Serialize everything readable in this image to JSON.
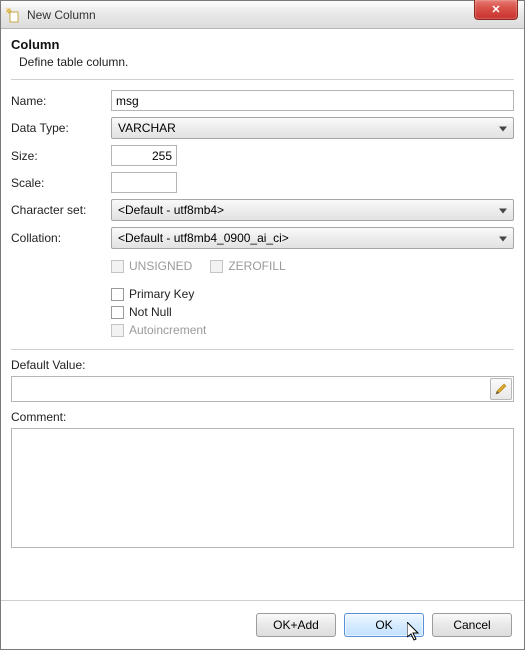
{
  "window": {
    "title": "New Column",
    "close_glyph": "✕"
  },
  "header": {
    "title": "Column",
    "subtitle": "Define table column."
  },
  "labels": {
    "name": "Name:",
    "datatype": "Data Type:",
    "size": "Size:",
    "scale": "Scale:",
    "charset": "Character set:",
    "collation": "Collation:",
    "unsigned": "UNSIGNED",
    "zerofill": "ZEROFILL",
    "primary": "Primary Key",
    "notnull": "Not Null",
    "autoinc": "Autoincrement",
    "default": "Default Value:",
    "comment": "Comment:"
  },
  "values": {
    "name": "msg",
    "datatype": "VARCHAR",
    "size": "255",
    "scale": "",
    "charset": "<Default - utf8mb4>",
    "collation": "<Default - utf8mb4_0900_ai_ci>",
    "default": "",
    "comment": ""
  },
  "buttons": {
    "okadd": "OK+Add",
    "ok": "OK",
    "cancel": "Cancel"
  },
  "icons": {
    "pencil_color": "#d8a72a"
  }
}
